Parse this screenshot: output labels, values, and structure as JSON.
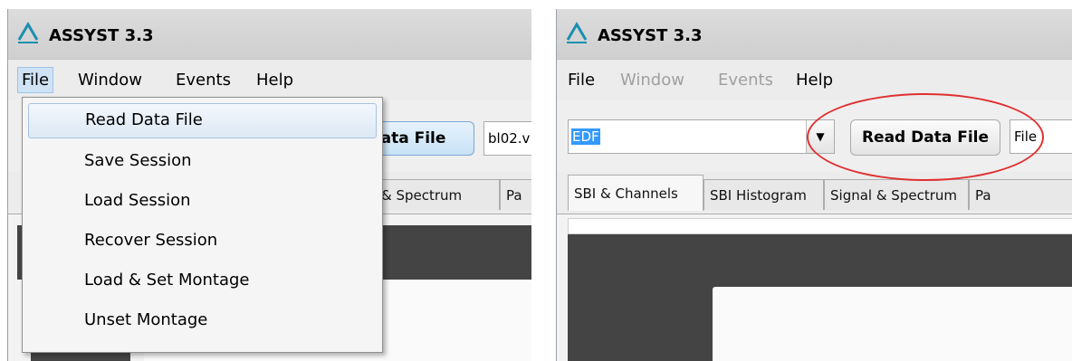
{
  "left_window": {
    "title": "ASSYST 3.3",
    "menu": {
      "file": "File",
      "window": "Window",
      "events": "Events",
      "help": "Help"
    },
    "file_menu_items": [
      "Read Data File",
      "Save Session",
      "Load Session",
      "Recover Session",
      "Load & Set Montage",
      "Unset Montage"
    ],
    "read_button_partial": "ata File",
    "file_field_partial": "bl02.v",
    "tabs_partial": [
      "& Spectrum",
      "Pa"
    ]
  },
  "right_window": {
    "title": "ASSYST 3.3",
    "menu": {
      "file": "File",
      "window": "Window",
      "events": "Events",
      "help": "Help"
    },
    "format_value": "EDF",
    "read_button_label": "Read Data File",
    "file_field_value": "File",
    "tabs": [
      "SBI & Channels",
      "SBI Histogram",
      "Signal & Spectrum",
      "Pa"
    ]
  },
  "colors": {
    "logo": "#1a8fb0",
    "annotation": "#e03030",
    "highlight": "#cfe3f5",
    "dark_area": "#444444"
  },
  "icons": [
    "app-logo-icon",
    "chevron-down-icon"
  ]
}
